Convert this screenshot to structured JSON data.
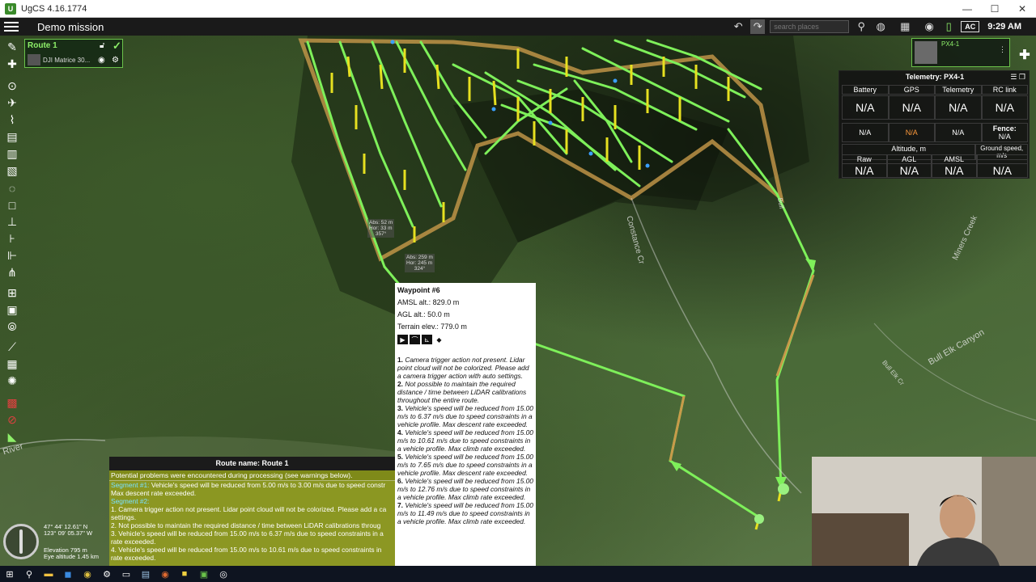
{
  "window": {
    "title": "UgCS 4.16.1774",
    "min": "—",
    "max": "☐",
    "close": "✕"
  },
  "toolbar": {
    "mission_title": "Demo mission",
    "search_placeholder": "search places",
    "ac_label": "AC",
    "clock": "9:29 AM"
  },
  "route_panel": {
    "name": "Route 1",
    "drone": "DJI Matrice 30..."
  },
  "vehicle": {
    "name": "PX4-1"
  },
  "telemetry": {
    "title": "Telemetry: PX4-1",
    "headers": [
      "Battery",
      "GPS",
      "Telemetry",
      "RC link"
    ],
    "values": [
      "N/A",
      "N/A",
      "N/A",
      "N/A"
    ],
    "row2": [
      "N/A",
      "N/A",
      "N/A"
    ],
    "fence_label": "Fence:",
    "fence_value": "N/A",
    "altitude_label": "Altitude, m",
    "alt_headers": [
      "Raw",
      "AGL",
      "AMSL"
    ],
    "alt_values": [
      "N/A",
      "N/A",
      "N/A"
    ],
    "ground_speed_label": "Ground speed, m/s",
    "ground_speed_value": "N/A"
  },
  "waypoint_popup": {
    "title": "Waypoint #6",
    "amsl": "AMSL alt.: 829.0 m",
    "agl": "AGL alt.: 50.0 m",
    "terrain": "Terrain elev.: 779.0 m",
    "warnings": [
      {
        "num": "1.",
        "text": "Camera trigger action not present. Lidar point cloud will not be colorized. Please add a camera trigger action with auto settings."
      },
      {
        "num": "2.",
        "text": "Not possible to maintain the required distance / time between LiDAR calibrations throughout the entire route."
      },
      {
        "num": "3.",
        "text": "Vehicle's speed will be reduced from 15.00 m/s to 6.37 m/s due to speed constraints in a vehicle profile. Max descent rate exceeded."
      },
      {
        "num": "4.",
        "text": "Vehicle's speed will be reduced from 15.00 m/s to 10.61 m/s due to speed constraints in a vehicle profile. Max climb rate exceeded."
      },
      {
        "num": "5.",
        "text": "Vehicle's speed will be reduced from 15.00 m/s to 7.65 m/s due to speed constraints in a vehicle profile. Max descent rate exceeded."
      },
      {
        "num": "6.",
        "text": "Vehicle's speed will be reduced from 15.00 m/s to 12.76 m/s due to speed constraints in a vehicle profile. Max climb rate exceeded."
      },
      {
        "num": "7.",
        "text": "Vehicle's speed will be reduced from 15.00 m/s to 11.49 m/s due to speed constraints in a vehicle profile. Max climb rate exceeded."
      }
    ]
  },
  "route_bar": {
    "label": "Route name: Route 1"
  },
  "warnings_box": {
    "header": "Potential problems were encountered during processing (see warnings below).",
    "seg1_label": "Segment #1:",
    "seg1_text": " Vehicle's speed will be reduced from 5.00 m/s to 3.00 m/s due to speed constr",
    "seg1_cont": "Max descent rate exceeded.",
    "seg2_label": "Segment #2:",
    "lines": [
      "1. Camera trigger action not present. Lidar point cloud will not be colorized. Please add a ca",
      "settings.",
      "2. Not possible to maintain the required distance / time between LiDAR calibrations throug",
      "3. Vehicle's speed will be reduced from 15.00 m/s to 6.37 m/s due to speed constraints in a",
      "rate exceeded.",
      "4. Vehicle's speed will be reduced from 15.00 m/s to 10.61 m/s due to speed constraints in",
      "rate exceeded."
    ]
  },
  "map": {
    "coord_lat": "47° 44' 12.61\" N",
    "coord_lon": "123° 09' 05.37\" W",
    "elevation": "Elevation 795 m",
    "eye_altitude": "Eye altitude 1.45 km",
    "labels": {
      "constance": "Constance Cr",
      "miners": "Miners Creek",
      "bull_elk": "Bull Elk Canyon",
      "bull_elk2": "Bull Elk Cr",
      "river": "River",
      "bull": "Bull"
    },
    "tip1": [
      "Abs: 52 m",
      "Hor: 33 m",
      "357°"
    ],
    "tip2": [
      "Abs: 259 m",
      "Hor: 245 m",
      "324°"
    ]
  },
  "colors": {
    "route": "#7ef05a",
    "accent": "#6ac24a",
    "orange": "#ff9a3c",
    "waypoint_pole": "#e6e020"
  }
}
